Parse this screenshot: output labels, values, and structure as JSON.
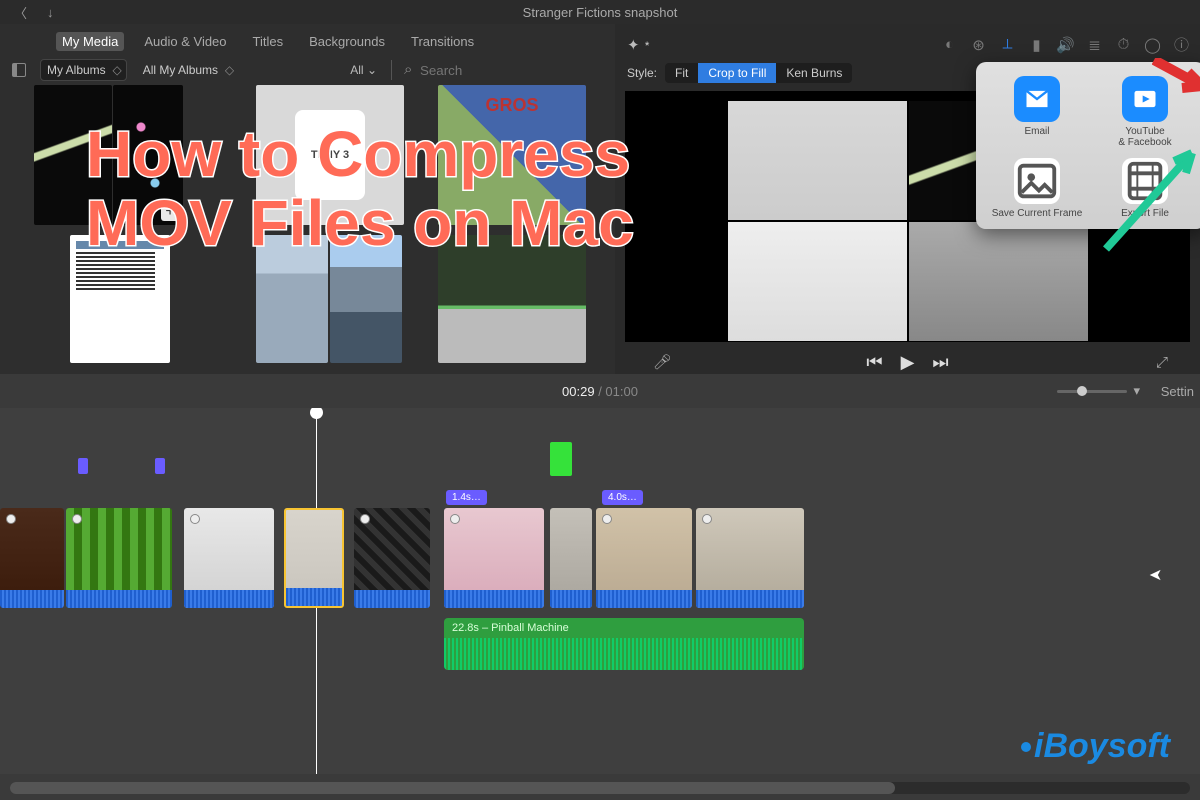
{
  "titlebar": {
    "title": "Stranger Fictions snapshot"
  },
  "tabs": [
    "My Media",
    "Audio & Video",
    "Titles",
    "Backgrounds",
    "Transitions"
  ],
  "tabs_active_index": 0,
  "browser": {
    "album_select": "My Albums",
    "path_select": "All My Albums",
    "filter_label": "All",
    "search_placeholder": "Search"
  },
  "thumbs": {
    "t2_text": "TENY\n  3",
    "t3_text": "GROS"
  },
  "style": {
    "label": "Style:",
    "options": [
      "Fit",
      "Crop to Fill",
      "Ken Burns"
    ],
    "active_index": 1
  },
  "share": {
    "email": "Email",
    "youtube": "YouTube\n& Facebook",
    "save_frame": "Save Current Frame",
    "export_file": "Export File"
  },
  "time": {
    "current": "00:29",
    "total": "01:00",
    "settings_label": "Settin"
  },
  "timeline": {
    "tag_a": "1.4s…",
    "tag_b": "4.0s…",
    "audio_label": "22.8s – Pinball Machine"
  },
  "overlay": {
    "headline_line1": "How to Compress",
    "headline_line2": "MOV Files on Mac",
    "watermark": "iBoysoft"
  }
}
